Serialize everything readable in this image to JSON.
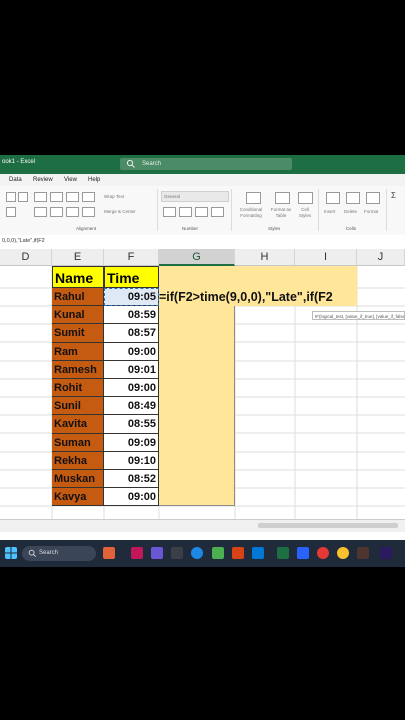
{
  "window": {
    "title": "ook1 - Excel"
  },
  "search": {
    "placeholder": "Search"
  },
  "menu": [
    "Data",
    "Review",
    "View",
    "Help"
  ],
  "ribbon": {
    "wrap_text": "Wrap Text",
    "merge_center": "Merge & Center",
    "number_format": "General",
    "conditional_formatting": "Conditional Formatting",
    "format_as_table": "Format as Table",
    "cell_styles": "Cell Styles",
    "insert": "Insert",
    "delete": "Delete",
    "format": "Format",
    "groups": {
      "alignment": "Alignment",
      "number": "Number",
      "styles": "Styles",
      "cells": "Cells"
    }
  },
  "formula_bar": {
    "content": "0,0,0),\"Late\",if(F2"
  },
  "columns": [
    "D",
    "E",
    "F",
    "G",
    "H",
    "I",
    "J"
  ],
  "selected_column": "G",
  "header_row": {
    "name": "Name",
    "time": "Time"
  },
  "rows": [
    {
      "name": "Rahul",
      "time": "09:05"
    },
    {
      "name": "Kunal",
      "time": "08:59"
    },
    {
      "name": "Sumit",
      "time": "08:57"
    },
    {
      "name": "Ram",
      "time": "09:00"
    },
    {
      "name": "Ramesh",
      "time": "09:01"
    },
    {
      "name": "Rohit",
      "time": "09:00"
    },
    {
      "name": "Sunil",
      "time": "08:49"
    },
    {
      "name": "Kavita",
      "time": "08:55"
    },
    {
      "name": "Suman",
      "time": "09:09"
    },
    {
      "name": "Rekha",
      "time": "09:10"
    },
    {
      "name": "Muskan",
      "time": "08:52"
    },
    {
      "name": "Kavya",
      "time": "09:00"
    }
  ],
  "formula_in_cell": "=if(F2>time(9,0,0),\"Late\",if(F2",
  "tooltip": "IF(logical_test, [value_if_true], [value_if_false])",
  "taskbar": {
    "search_label": "Search"
  },
  "colors": {
    "excel_green": "#1e6e43",
    "name_fill": "#c55a11",
    "header_fill": "#ffff00",
    "g_fill": "#ffe699"
  }
}
